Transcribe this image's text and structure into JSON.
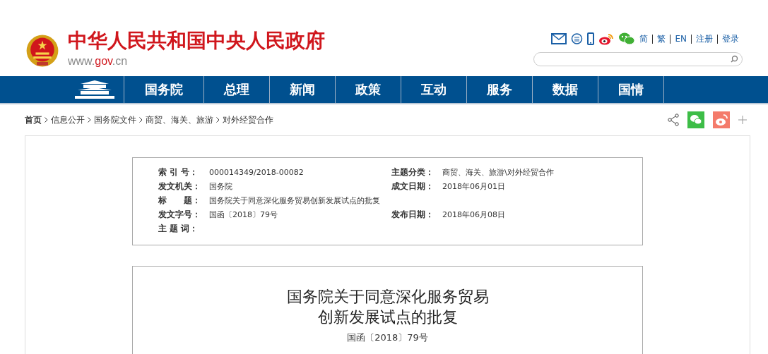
{
  "header": {
    "title": "中华人民共和国中央人民政府",
    "url": [
      {
        "text": "www.",
        "kind": "plain"
      },
      {
        "text": "gov",
        "kind": "accent"
      },
      {
        "text": ".cn",
        "kind": "plain"
      }
    ]
  },
  "top_links": [
    "简",
    "繁",
    "EN",
    "注册",
    "登录"
  ],
  "nav": [
    {
      "label": "国务院"
    },
    {
      "label": "总理"
    },
    {
      "label": "新闻"
    },
    {
      "label": "政策"
    },
    {
      "label": "互动"
    },
    {
      "label": "服务"
    },
    {
      "label": "数据"
    },
    {
      "label": "国情"
    }
  ],
  "breadcrumb": [
    "首页",
    "信息公开",
    "国务院文件",
    "商贸、海关、旅游",
    "对外经贸合作"
  ],
  "metadata": [
    [
      {
        "label": "索 引 号：",
        "value": "000014349/2018-00082"
      },
      {
        "label": "主题分类：",
        "value": "商贸、海关、旅游\\对外经贸合作"
      }
    ],
    [
      {
        "label": "发文机关：",
        "value": "国务院"
      },
      {
        "label": "成文日期：",
        "value": "2018年06月01日"
      }
    ],
    [
      {
        "label": "标　　题：",
        "value": "国务院关于同意深化服务贸易创新发展试点的批复"
      }
    ],
    [
      {
        "label": "发文字号：",
        "value": "国函〔2018〕79号"
      },
      {
        "label": "发布日期：",
        "value": "2018年06月08日"
      }
    ],
    [
      {
        "label": "主 题 词："
      }
    ]
  ],
  "article": {
    "title_lines": [
      "国务院关于同意深化服务贸易",
      "创新发展试点的批复"
    ],
    "doc_number": "国函〔2018〕79号"
  }
}
